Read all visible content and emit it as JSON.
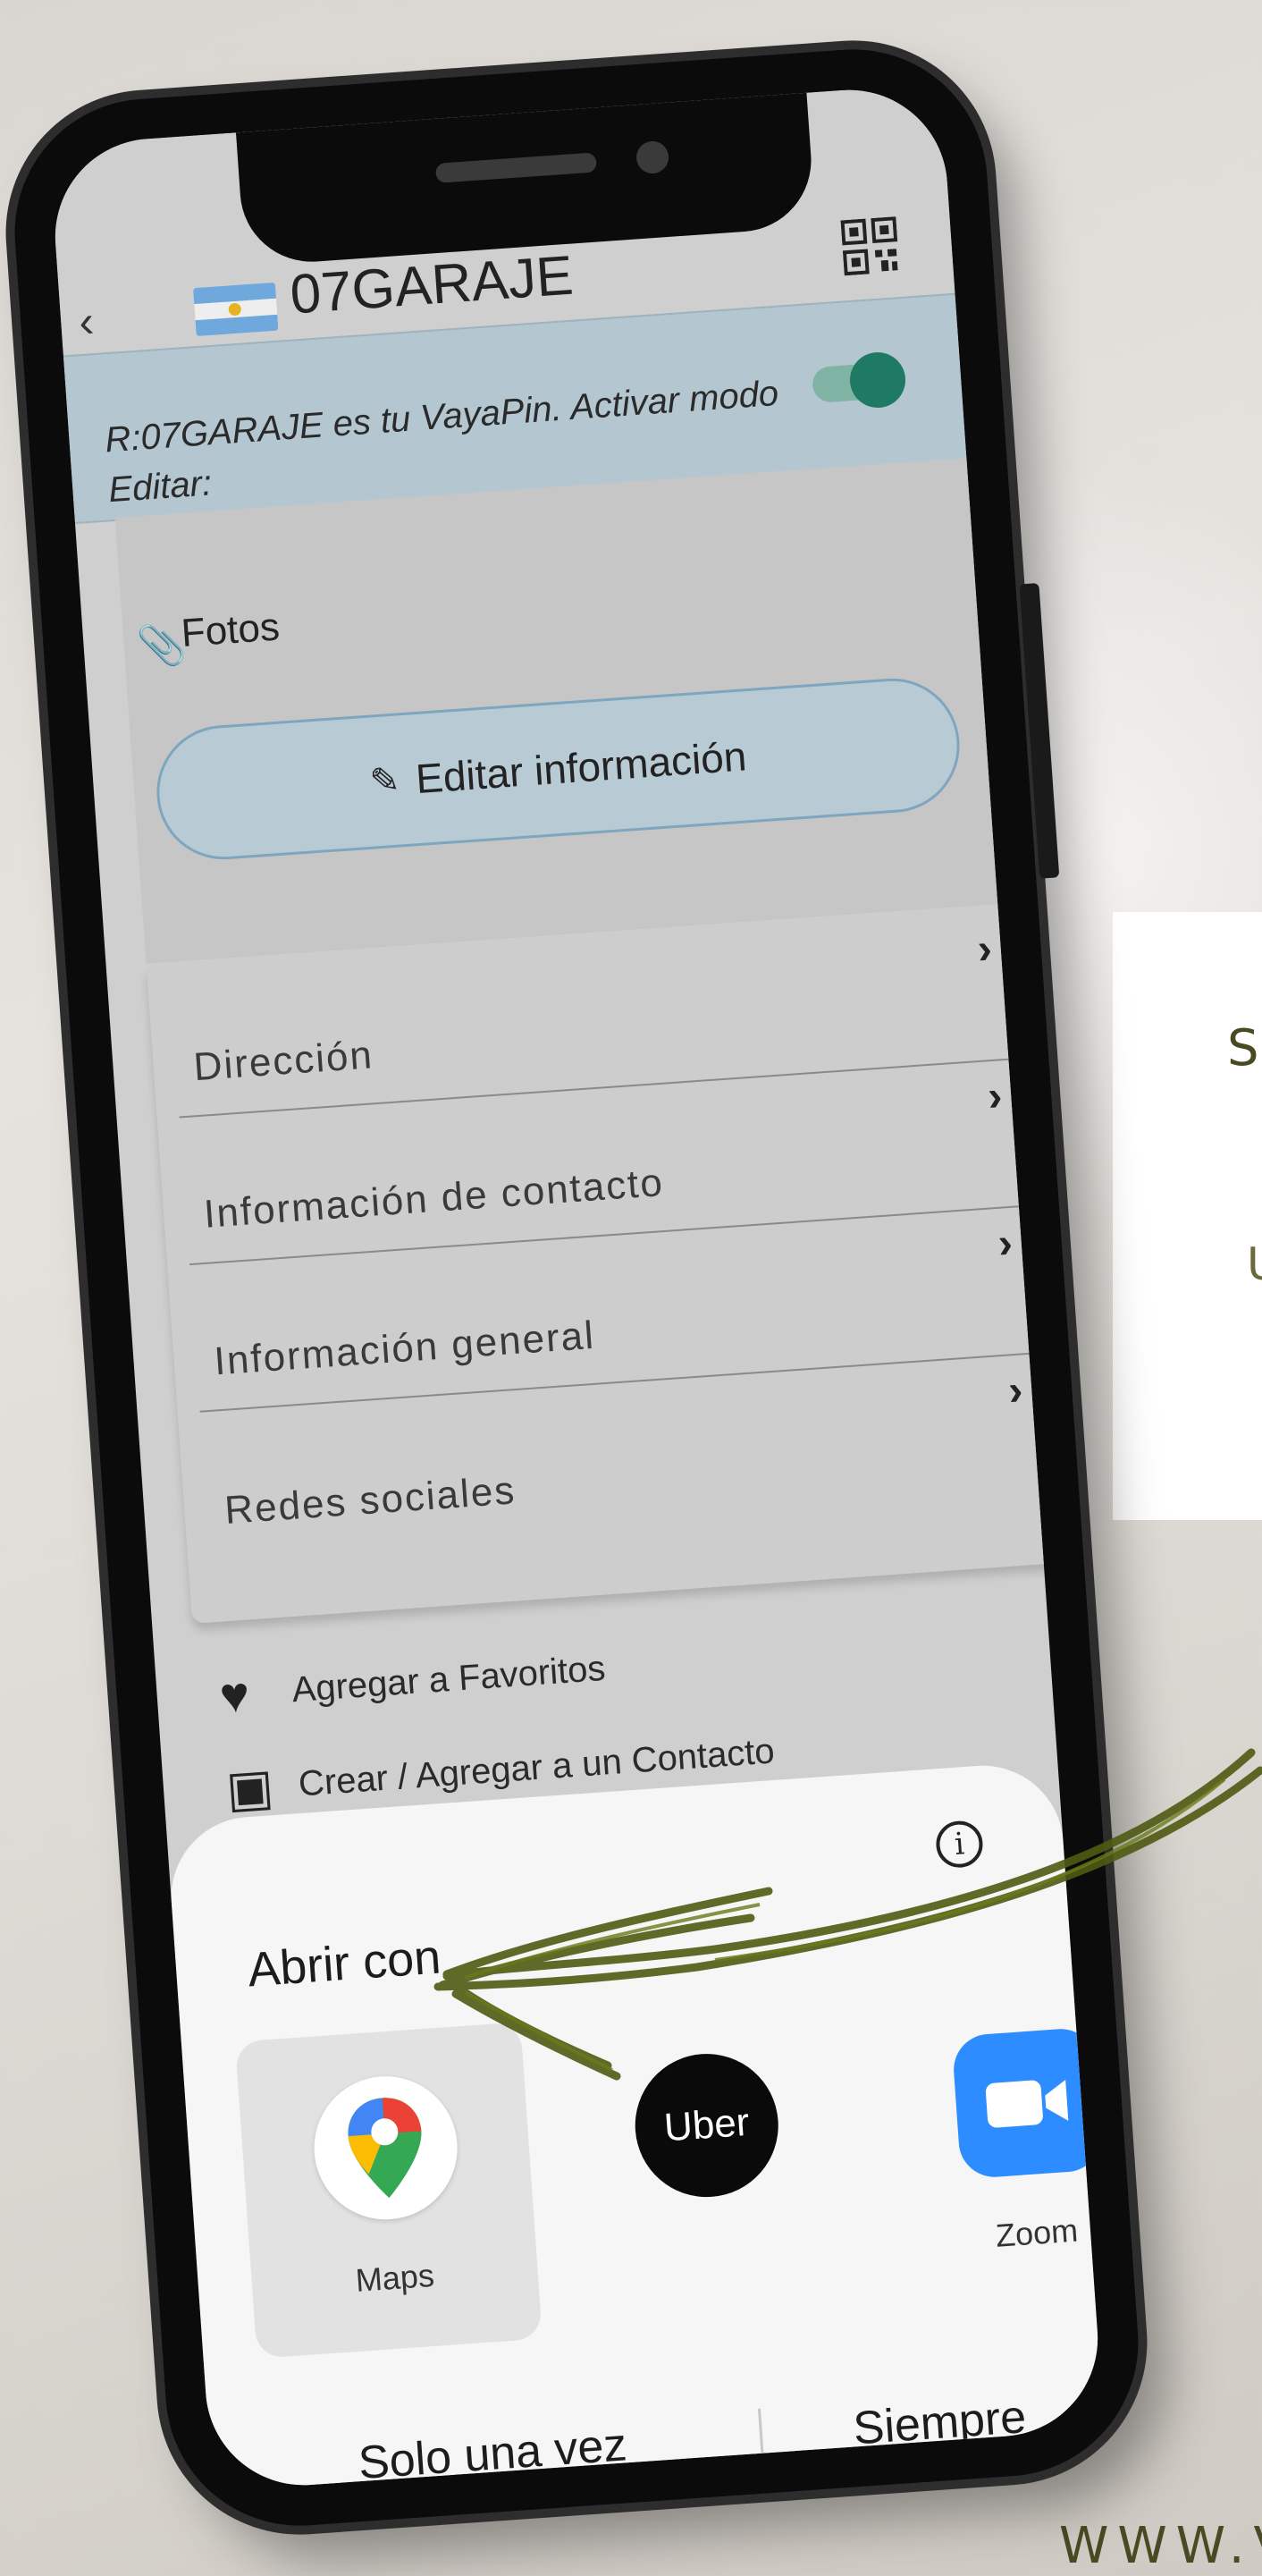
{
  "app": {
    "title": "07GARAJE",
    "banner_text": "R:07GARAJE es tu VayaPin. Activar modo Editar:",
    "toggle_on": true
  },
  "edit_section": {
    "photos_label": "Fotos",
    "edit_button_label": "Editar información"
  },
  "menu": {
    "items": [
      {
        "label": "Dirección"
      },
      {
        "label": "Información de contacto"
      },
      {
        "label": "Información general"
      },
      {
        "label": "Redes sociales"
      }
    ]
  },
  "actions": [
    {
      "label": "Agregar a Favoritos",
      "icon": "heart-icon"
    },
    {
      "label": "Crear / Agregar a un Contacto",
      "icon": "contact-icon"
    }
  ],
  "sheet": {
    "title": "Abrir con",
    "apps": [
      {
        "name": "Maps",
        "icon": "google-maps-icon",
        "selected": true
      },
      {
        "name": "Uber",
        "icon": "uber-icon",
        "selected": false
      },
      {
        "name": "Zoom",
        "icon": "zoom-icon",
        "selected": false
      }
    ],
    "once_label": "Solo una vez",
    "always_label": "Siempre"
  },
  "background": {
    "card_letter_1": "S",
    "card_letter_2": "U",
    "website_text": "WWW.V"
  },
  "colors": {
    "banner": "#b4c7d1",
    "toggle_knob": "#1e7a63",
    "zoom_blue": "#2d8cff",
    "scribble": "#4f5a12"
  }
}
